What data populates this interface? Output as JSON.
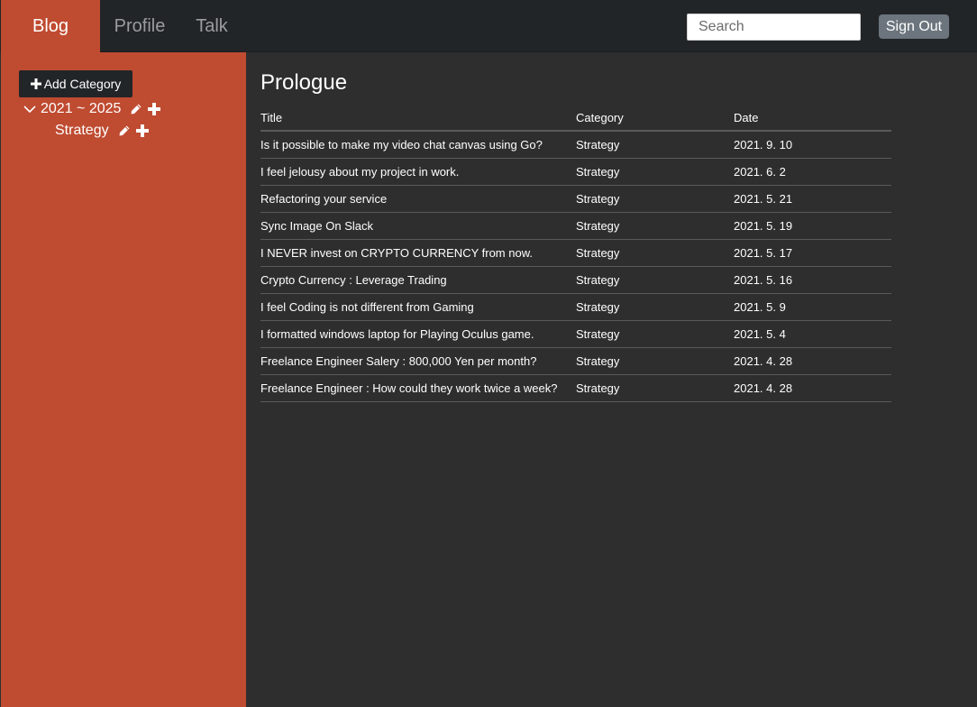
{
  "nav": {
    "tabs": [
      {
        "label": "Blog",
        "active": true
      },
      {
        "label": "Profile",
        "active": false
      },
      {
        "label": "Talk",
        "active": false
      }
    ],
    "search_placeholder": "Search",
    "sign_out_label": "Sign Out"
  },
  "sidebar": {
    "add_category_label": "Add Category",
    "tree": {
      "label": "2021 ~ 2025",
      "expanded": true,
      "children": [
        {
          "label": "Strategy"
        }
      ]
    }
  },
  "main": {
    "title": "Prologue",
    "columns": [
      "Title",
      "Category",
      "Date"
    ],
    "rows": [
      {
        "title": "Is it possible to make my video chat canvas using Go?",
        "category": "Strategy",
        "date": "2021. 9. 10"
      },
      {
        "title": "I feel jelousy about my project in work.",
        "category": "Strategy",
        "date": "2021. 6. 2"
      },
      {
        "title": "Refactoring your service",
        "category": "Strategy",
        "date": "2021. 5. 21"
      },
      {
        "title": "Sync Image On Slack",
        "category": "Strategy",
        "date": "2021. 5. 19"
      },
      {
        "title": "I NEVER invest on CRYPTO CURRENCY from now.",
        "category": "Strategy",
        "date": "2021. 5. 17"
      },
      {
        "title": "Crypto Currency : Leverage Trading",
        "category": "Strategy",
        "date": "2021. 5. 16"
      },
      {
        "title": "I feel Coding is not different from Gaming",
        "category": "Strategy",
        "date": "2021. 5. 9"
      },
      {
        "title": "I formatted windows laptop for Playing Oculus game.",
        "category": "Strategy",
        "date": "2021. 5. 4"
      },
      {
        "title": "Freelance Engineer Salery : 800,000 Yen per month?",
        "category": "Strategy",
        "date": "2021. 4. 28"
      },
      {
        "title": "Freelance Engineer : How could they work twice a week?",
        "category": "Strategy",
        "date": "2021. 4. 28"
      }
    ]
  },
  "colors": {
    "accent": "#bf4b31",
    "navbar": "#222528",
    "background": "#2e2e2e",
    "button_secondary": "#6c757d"
  }
}
